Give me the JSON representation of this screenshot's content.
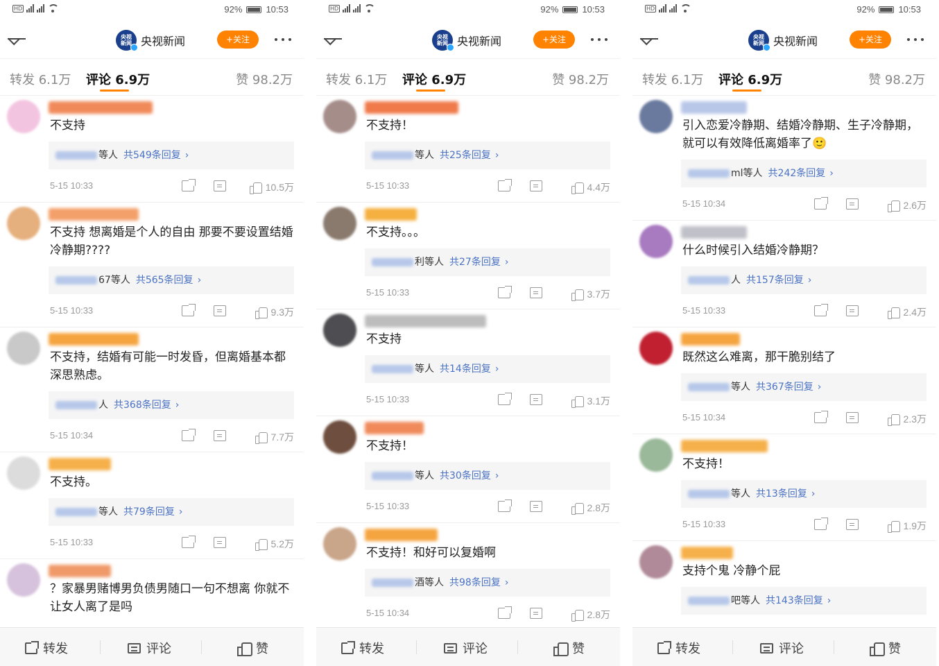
{
  "colors": {
    "accent": "#ff8200",
    "link": "#4a72c4",
    "muted": "#999999",
    "reply_bg": "#f5f5f5"
  },
  "statusbar": {
    "battery": "92%",
    "time": "10:53",
    "battery_level": 0.92
  },
  "header": {
    "account_name": "央视新闻",
    "logo_line1": "央视",
    "logo_line2": "新闻",
    "follow_label": "+关注"
  },
  "tabs": {
    "repost": "转发 6.1万",
    "comment": "评论 6.9万",
    "like": "赞 98.2万"
  },
  "bottombar": {
    "repost": "转发",
    "comment": "评论",
    "like": "赞"
  },
  "panels": [
    {
      "comments": [
        {
          "text": "不支持",
          "reply_names": "等人",
          "reply_total": "共549条回复",
          "time": "5-15 10:33",
          "likes": "10.5万"
        },
        {
          "text": "不支持 想离婚是个人的自由 那要不要设置结婚冷静期????",
          "reply_names": "67等人",
          "reply_total": "共565条回复",
          "time": "5-15 10:33",
          "likes": "9.3万"
        },
        {
          "text": "不支持，结婚有可能一时发昏，但离婚基本都深思熟虑。",
          "reply_names": "人",
          "reply_total": "共368条回复",
          "time": "5-15 10:34",
          "likes": "7.7万"
        },
        {
          "text": "不支持。",
          "reply_names": "等人",
          "reply_total": "共79条回复",
          "time": "5-15 10:33",
          "likes": "5.2万"
        },
        {
          "text": "？家暴男赌博男负债男随口一句不想离 你就不让女人离了是吗",
          "reply_names": "",
          "reply_total": "",
          "time": "",
          "likes": ""
        }
      ]
    },
    {
      "comments": [
        {
          "text": "不支持！",
          "reply_names": "等人",
          "reply_total": "共25条回复",
          "time": "5-15 10:33",
          "likes": "4.4万"
        },
        {
          "text": "不支持。。。",
          "reply_names": "利等人",
          "reply_total": "共27条回复",
          "time": "5-15 10:33",
          "likes": "3.7万"
        },
        {
          "text": "不支持",
          "reply_names": "等人",
          "reply_total": "共14条回复",
          "time": "5-15 10:33",
          "likes": "3.1万"
        },
        {
          "text": "不支持！",
          "reply_names": "等人",
          "reply_total": "共30条回复",
          "time": "5-15 10:33",
          "likes": "2.8万"
        },
        {
          "text": "不支持！和好可以复婚啊",
          "reply_names": "酒等人",
          "reply_total": "共98条回复",
          "time": "5-15 10:34",
          "likes": "2.8万"
        }
      ]
    },
    {
      "comments": [
        {
          "text": "引入恋爱冷静期、结婚冷静期、生子冷静期，就可以有效降低离婚率了🙂",
          "reply_names": "ml等人",
          "reply_total": "共242条回复",
          "time": "5-15 10:34",
          "likes": "2.6万"
        },
        {
          "text": "什么时候引入结婚冷静期？",
          "reply_names": "人",
          "reply_total": "共157条回复",
          "time": "5-15 10:33",
          "likes": "2.4万"
        },
        {
          "text": "既然这么难离，那干脆别结了",
          "reply_names": "等人",
          "reply_total": "共367条回复",
          "time": "5-15 10:34",
          "likes": "2.3万"
        },
        {
          "text": "不支持！",
          "reply_names": "等人",
          "reply_total": "共13条回复",
          "time": "5-15 10:33",
          "likes": "1.9万"
        },
        {
          "text": "支持个鬼 冷静个屁",
          "reply_names": "吧等人",
          "reply_total": "共143条回复",
          "time": "",
          "likes": ""
        }
      ]
    }
  ]
}
